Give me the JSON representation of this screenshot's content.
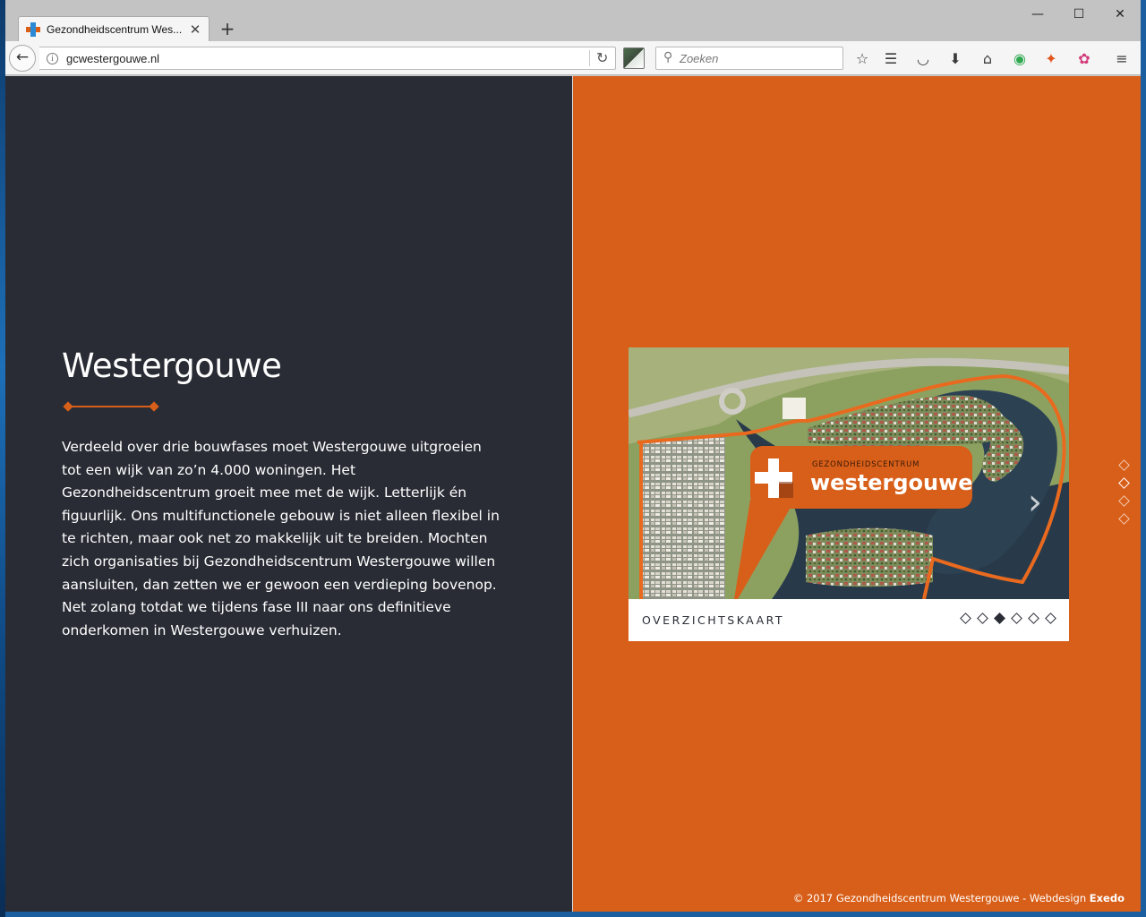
{
  "browser": {
    "tab_title": "Gezondheidscentrum Wes...",
    "new_tab": "+",
    "url": "gcwestergouwe.nl",
    "search_placeholder": "Zoeken"
  },
  "window_controls": {
    "minimize": "—",
    "maximize": "☐",
    "close": "✕"
  },
  "icons": {
    "favicon": "plus-cross-icon",
    "back": "arrow-left-icon",
    "info": "info-icon",
    "reload": "reload-icon",
    "search": "search-icon",
    "toolbar": [
      "star-icon",
      "reading-list-icon",
      "pocket-icon",
      "download-icon",
      "home-icon",
      "chat-extension-icon",
      "addon-extension-icon",
      "colorful-extension-icon",
      "menu-icon"
    ]
  },
  "page": {
    "heading": "Westergouwe",
    "body": "Verdeeld over drie bouwfases moet Westergouwe uitgroeien tot een wijk van zo’n 4.000 woningen. Het Gezondheidscentrum groeit mee met de wijk. Letterlijk én figuurlijk. Ons multifunctionele gebouw is niet alleen flexibel in te richten, maar ook net zo makkelijk uit te breiden. Mochten zich organisaties bij Gezondheidscentrum Westergouwe willen aansluiten, dan zetten we er gewoon een verdieping bovenop. Net zolang totdat we tijdens fase III naar ons definitieve onderkomen in Westergouwe verhuizen.",
    "slider": {
      "logo_small": "GEZONDHEIDSCENTRUM",
      "logo_main": "westergouwe",
      "caption": "OVERZICHTSKAART",
      "slide_count": 6,
      "active_slide": 3
    },
    "section_nav": {
      "count": 4,
      "active": 2
    },
    "footer": {
      "text": "© 2017 Gezondheidscentrum Westergouwe - Webdesign",
      "brand": "Exedo"
    }
  },
  "colors": {
    "dark_panel": "#2a2c35",
    "accent_orange": "#d85f19"
  }
}
